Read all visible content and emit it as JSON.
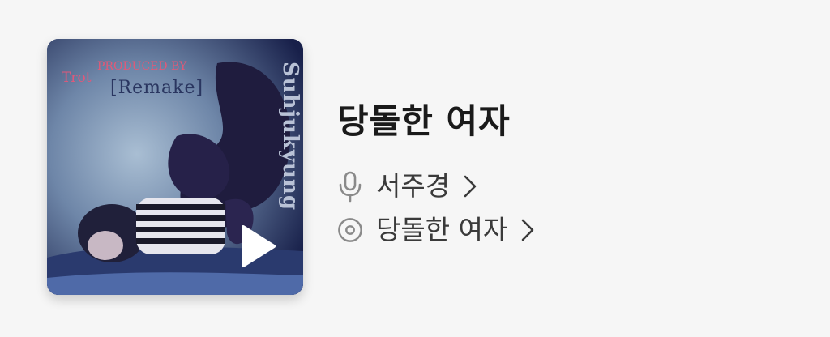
{
  "album": {
    "cover": {
      "texts": {
        "line1": "PRODUCED BY",
        "line2": "Trot",
        "line3": "[Remake]",
        "vertical": "Suhjukyung"
      }
    },
    "title": "당돌한 여자"
  },
  "artist": {
    "name": "서주경",
    "icon": "microphone-icon"
  },
  "album_link": {
    "name": "당돌한 여자",
    "icon": "disc-icon"
  },
  "controls": {
    "play_icon": "play-icon",
    "chevron_icon": "chevron-right-icon"
  },
  "colors": {
    "background": "#f6f6f6",
    "title": "#1a1a1a",
    "meta_text": "#3a3a3a",
    "icon_gray": "#8a8a8a"
  }
}
